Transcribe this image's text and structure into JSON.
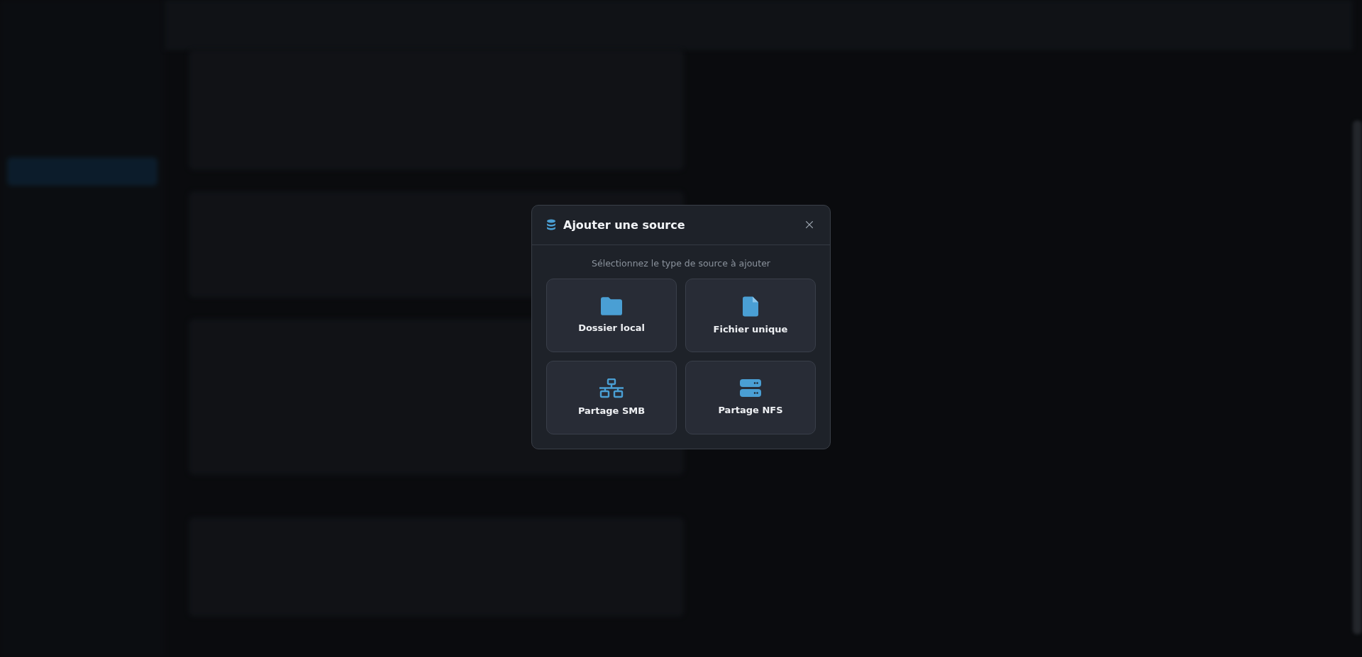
{
  "dialog": {
    "title": "Ajouter une source",
    "subtitle": "Sélectionnez le type de source à ajouter",
    "options": [
      {
        "kind": "folder",
        "label": "Dossier local"
      },
      {
        "kind": "file",
        "label": "Fichier unique"
      },
      {
        "kind": "network",
        "label": "Partage SMB"
      },
      {
        "kind": "server",
        "label": "Partage NFS"
      }
    ]
  }
}
